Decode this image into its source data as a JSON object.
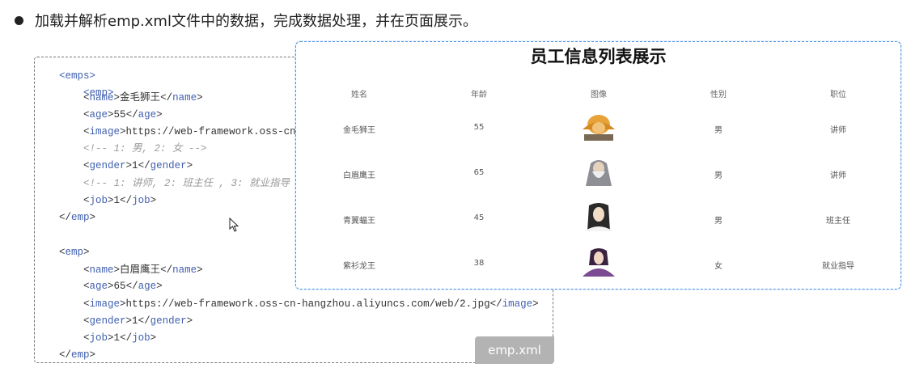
{
  "intro": {
    "text": "加载并解析emp.xml文件中的数据，完成数据处理，并在页面展示。"
  },
  "xml": {
    "root_open": "emps",
    "emp_tag": "emp",
    "lines": [
      {
        "tag": "name",
        "value": "金毛狮王"
      },
      {
        "tag": "age",
        "value": "55"
      },
      {
        "tag": "image",
        "value": "https://web-framework.oss-cn"
      },
      {
        "comment": "<!-- 1: 男, 2: 女 -->"
      },
      {
        "tag": "gender",
        "value": "1"
      },
      {
        "comment": "<!-- 1: 讲师, 2: 班主任 , 3: 就业指导"
      },
      {
        "tag": "job",
        "value": "1"
      }
    ],
    "lines2": [
      {
        "tag": "name",
        "value": "白眉鹰王"
      },
      {
        "tag": "age",
        "value": "65"
      },
      {
        "tag": "image",
        "value": "https://web-framework.oss-cn-hangzhou.aliyuncs.com/web/2.jpg"
      },
      {
        "tag": "gender",
        "value": "1"
      },
      {
        "tag": "job",
        "value": "1"
      }
    ],
    "file_label": "emp.xml"
  },
  "panel": {
    "title": "员工信息列表展示",
    "headers": [
      "姓名",
      "年龄",
      "图像",
      "性别",
      "职位"
    ],
    "rows": [
      {
        "name": "金毛狮王",
        "age": "55",
        "gender": "男",
        "job": "讲师",
        "avatar": "avatar-orange"
      },
      {
        "name": "白眉鹰王",
        "age": "65",
        "gender": "男",
        "job": "讲师",
        "avatar": "avatar-grey"
      },
      {
        "name": "青翼蝠王",
        "age": "45",
        "gender": "男",
        "job": "班主任",
        "avatar": "avatar-dark"
      },
      {
        "name": "紫衫龙王",
        "age": "38",
        "gender": "女",
        "job": "就业指导",
        "avatar": "avatar-purple"
      }
    ]
  }
}
